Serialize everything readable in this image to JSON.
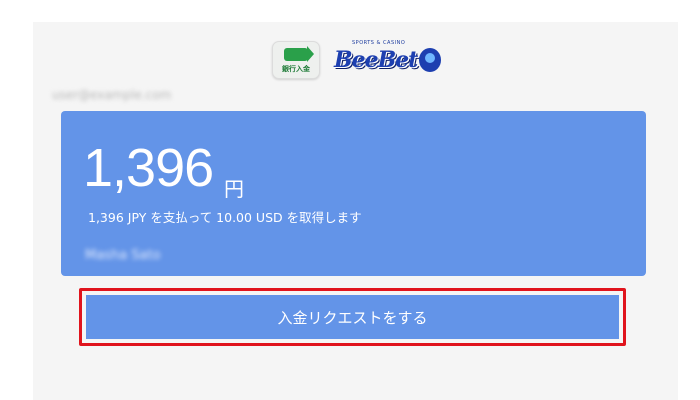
{
  "logos": {
    "bank_icon_name": "bank-transfer-icon",
    "bank_icon_text": "銀行入金",
    "brand_small_text": "SPORTS & CASINO",
    "brand_name": "BeeBet"
  },
  "user": {
    "email": "user@example.com",
    "name": "Masha Sato"
  },
  "payment": {
    "amount": "1,396",
    "currency_suffix": "円",
    "description": "1,396 JPY を支払って 10.00 USD を取得します"
  },
  "actions": {
    "submit_label": "入金リクエストをする"
  },
  "colors": {
    "card_bg": "#6394e8",
    "highlight_border": "#e0141d"
  }
}
